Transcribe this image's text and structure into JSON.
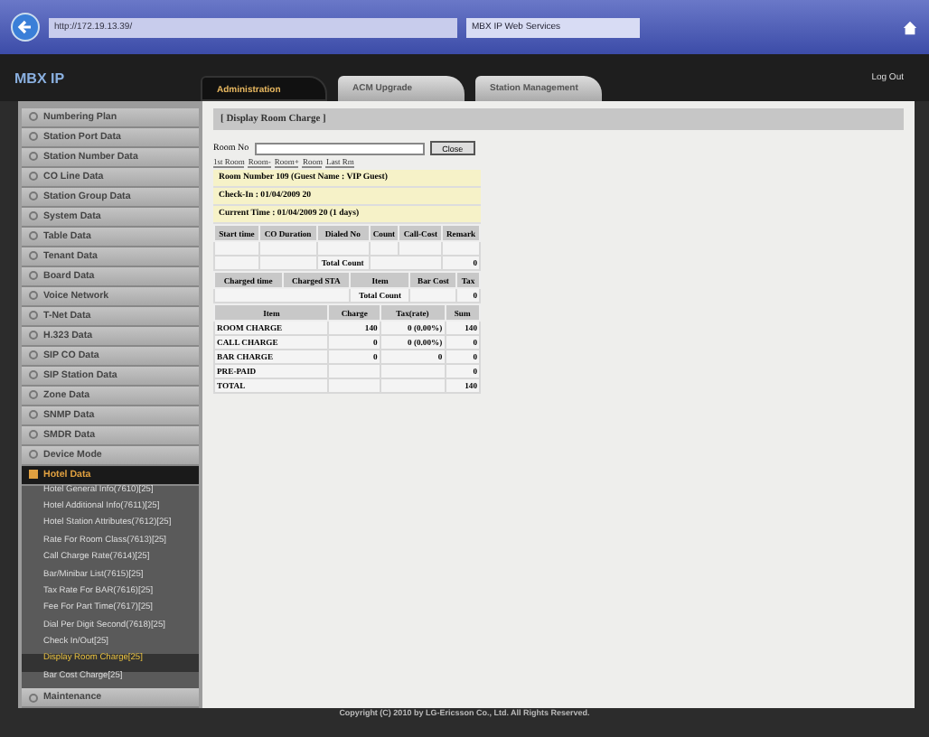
{
  "browser": {
    "address": "http://172.19.13.39/",
    "tab_title": "MBX IP Web Services"
  },
  "header": {
    "logo": "MBX IP",
    "tabs": [
      {
        "label": "Administration",
        "selected": true
      },
      {
        "label": "ACM Upgrade",
        "selected": false
      },
      {
        "label": "Station Management",
        "selected": false
      }
    ],
    "logout": "Log Out"
  },
  "sidebar": {
    "items": [
      {
        "label": "Numbering Plan",
        "expanded": false,
        "selected": false
      },
      {
        "label": "Station Port Data",
        "expanded": false,
        "selected": false
      },
      {
        "label": "Station Number Data",
        "expanded": false,
        "selected": false
      },
      {
        "label": "CO Line Data",
        "expanded": false,
        "selected": false
      },
      {
        "label": "Station Group Data",
        "expanded": false,
        "selected": false
      },
      {
        "label": "System Data",
        "expanded": false,
        "selected": false
      },
      {
        "label": "Table Data",
        "expanded": false,
        "selected": false
      },
      {
        "label": "Tenant Data",
        "expanded": false,
        "selected": false
      },
      {
        "label": "Board Data",
        "expanded": false,
        "selected": false
      },
      {
        "label": "Voice Network",
        "expanded": false,
        "selected": false
      },
      {
        "label": "T-Net Data",
        "expanded": false,
        "selected": false
      },
      {
        "label": "H.323 Data",
        "expanded": false,
        "selected": false
      },
      {
        "label": "SIP CO Data",
        "expanded": false,
        "selected": false
      },
      {
        "label": "SIP Station Data",
        "expanded": false,
        "selected": false
      },
      {
        "label": "Zone Data",
        "expanded": false,
        "selected": false
      },
      {
        "label": "SNMP Data",
        "expanded": false,
        "selected": false
      },
      {
        "label": "SMDR Data",
        "expanded": false,
        "selected": false
      },
      {
        "label": "Device Mode",
        "expanded": false,
        "selected": false
      },
      {
        "label": "Hotel Data",
        "expanded": true,
        "selected": true,
        "children": [
          {
            "label": "Hotel General Info(7610)[25]",
            "selected": false
          },
          {
            "label": "Hotel Additional Info(7611)[25]",
            "selected": false
          },
          {
            "label": "Hotel Station Attributes(7612)[25]",
            "selected": false
          },
          {
            "label": "Rate For Room Class(7613)[25]",
            "selected": false
          },
          {
            "label": "Call Charge Rate(7614)[25]",
            "selected": false
          },
          {
            "label": "Bar/Minibar List(7615)[25]",
            "selected": false
          },
          {
            "label": "Tax Rate For BAR(7616)[25]",
            "selected": false
          },
          {
            "label": "Fee For Part Time(7617)[25]",
            "selected": false
          },
          {
            "label": "Dial Per Digit Second(7618)[25]",
            "selected": false
          },
          {
            "label": "Check In/Out[25]",
            "selected": false
          },
          {
            "label": "Display Room Charge[25]",
            "selected": true
          },
          {
            "label": "Bar Cost Charge[25]",
            "selected": false
          }
        ]
      },
      {
        "label": "Maintenance",
        "expanded": false,
        "selected": false
      }
    ]
  },
  "content": {
    "title": "[ Display Room Charge ]",
    "room_label": "Room No",
    "button": "Close",
    "nav_links": [
      "1st Room",
      "Room-",
      "Room+",
      "Room",
      "Last Rm"
    ],
    "info_lines": [
      "Room Number 109 (Guest Name : VIP Guest)",
      "Check-In : 01/04/2009 20",
      "Current Time : 01/04/2009 20 (1 days)"
    ],
    "call_table": {
      "columns": [
        "Start time",
        "CO Duration",
        "Dialed No",
        "Count",
        "Call-Cost",
        "Remark"
      ],
      "total_label": "Total Count",
      "total_value": "0"
    },
    "bar_table": {
      "columns": [
        "Charged time",
        "Charged STA",
        "Item",
        "Bar Cost",
        "Tax"
      ],
      "total_label": "Total Count",
      "total_value": "0"
    },
    "charge_table": {
      "columns": [
        "Item",
        "Charge",
        "Tax(rate)",
        "Sum"
      ],
      "rows": [
        {
          "item": "ROOM CHARGE",
          "charge": "140",
          "tax": "0 (0.00%)",
          "sum": "140"
        },
        {
          "item": "CALL CHARGE",
          "charge": "0",
          "tax": "0 (0.00%)",
          "sum": "0"
        },
        {
          "item": "BAR CHARGE",
          "charge": "0",
          "tax": "0",
          "sum": "0"
        },
        {
          "item": "PRE-PAID",
          "sum": "0"
        },
        {
          "item": "TOTAL",
          "sum": "140"
        }
      ]
    }
  },
  "footer": "Copyright (C) 2010 by LG-Ericsson Co., Ltd. All Rights Reserved."
}
